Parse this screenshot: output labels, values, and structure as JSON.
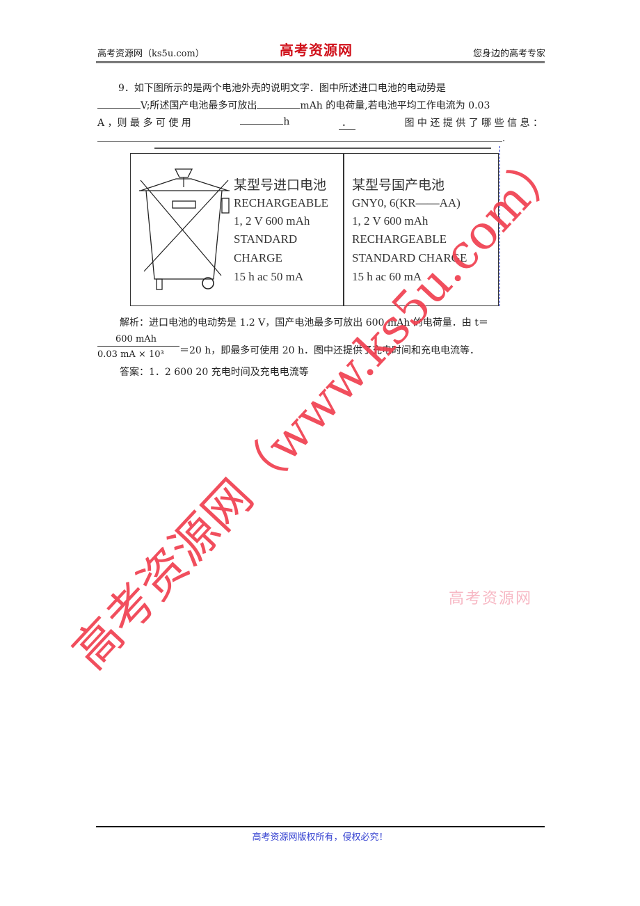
{
  "header": {
    "left": "高考资源网（ks5u.com）",
    "logo": "高考资源网",
    "right": "您身边的高考专家"
  },
  "question": {
    "number": "9．",
    "line1": "如下图所示的是两个电池外壳的说明文字．图中所述进口电池的电动势是",
    "line2_a": "V;所述国产电池最多可放出",
    "line2_b": "mAh 的电荷量,若电池平均工作电流为 0.03",
    "line3_a": "A ，则 最 多 可 使 用",
    "line3_b": "h",
    "line3_c": "．",
    "line3_d": "图 中 还 提 供 了 哪 些 信 息 ：",
    "line4_end": "."
  },
  "figure": {
    "imported": {
      "title": "某型号进口电池",
      "lines": [
        "RECHARGEABLE",
        "1, 2 V   600 mAh",
        "STANDARD",
        "CHARGE",
        "15 h   ac   50 mA"
      ]
    },
    "domestic": {
      "title": "某型号国产电池",
      "lines": [
        "GNY0, 6(KR——AA)",
        "1, 2 V   600 mAh",
        "RECHARGEABLE",
        "STANDARD CHARGE",
        "15 h   ac   60 mA"
      ]
    },
    "icon": "crossed-out-wheelie-bin-icon"
  },
  "analysis": {
    "line1": "解析：进口电池的电动势是 1.2 V，国产电池最多可放出 600 mAh 的电荷量．由 t＝",
    "frac_num": "600   mAh",
    "frac_den": "0.03   mA  ×  10³",
    "line2": "＝20 h，即最多可使用 20 h．图中还提供了充电时间和充电电流等．",
    "answer": "答案：1．2   600   20   充电时间及充电电流等"
  },
  "watermark": {
    "main": "高考资源网（www.ks5u.com）",
    "small": "高考资源网"
  },
  "footer": {
    "text": "高考资源网版权所有，侵权必究！"
  }
}
